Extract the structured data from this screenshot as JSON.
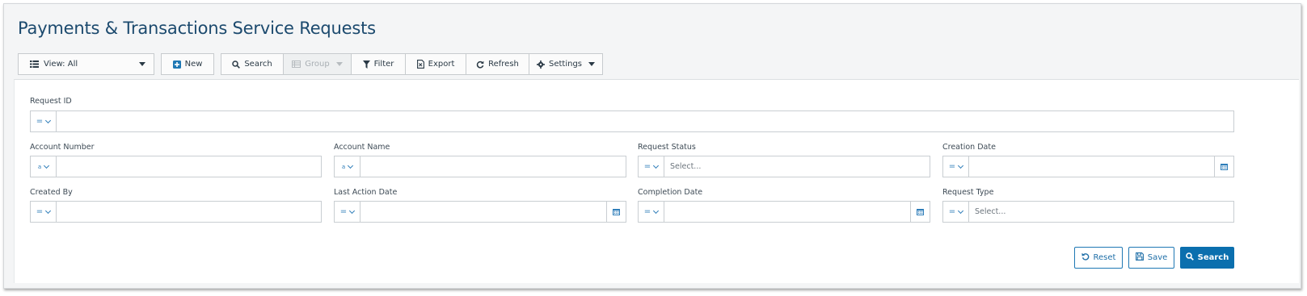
{
  "page": {
    "title": "Payments & Transactions Service Requests"
  },
  "toolbar": {
    "view_label": "View: All",
    "new_label": "New",
    "search_label": "Search",
    "group_label": "Group",
    "filter_label": "Filter",
    "export_label": "Export",
    "refresh_label": "Refresh",
    "settings_label": "Settings"
  },
  "form": {
    "request_id": {
      "label": "Request ID",
      "operator": "="
    },
    "account_number": {
      "label": "Account Number",
      "operator": "a"
    },
    "account_name": {
      "label": "Account Name",
      "operator": "a"
    },
    "request_status": {
      "label": "Request Status",
      "operator": "=",
      "placeholder": "Select..."
    },
    "creation_date": {
      "label": "Creation Date",
      "operator": "="
    },
    "created_by": {
      "label": "Created By",
      "operator": "="
    },
    "last_action_date": {
      "label": "Last Action Date",
      "operator": "="
    },
    "completion_date": {
      "label": "Completion Date",
      "operator": "="
    },
    "request_type": {
      "label": "Request Type",
      "operator": "=",
      "placeholder": "Select..."
    }
  },
  "actions": {
    "reset_label": "Reset",
    "save_label": "Save",
    "search_label": "Search"
  },
  "colors": {
    "title": "#1c4a6e",
    "accent": "#0b6fae",
    "operator": "#2e7db9",
    "panel_bg": "#f4f5f6"
  },
  "icons": {
    "view": "list-icon",
    "new": "plus-square-icon",
    "search": "search-icon",
    "group": "group-icon",
    "filter": "filter-icon",
    "export": "export-icon",
    "refresh": "refresh-icon",
    "settings": "gear-icon",
    "calendar": "calendar-icon",
    "reset": "undo-icon",
    "save": "save-icon"
  }
}
